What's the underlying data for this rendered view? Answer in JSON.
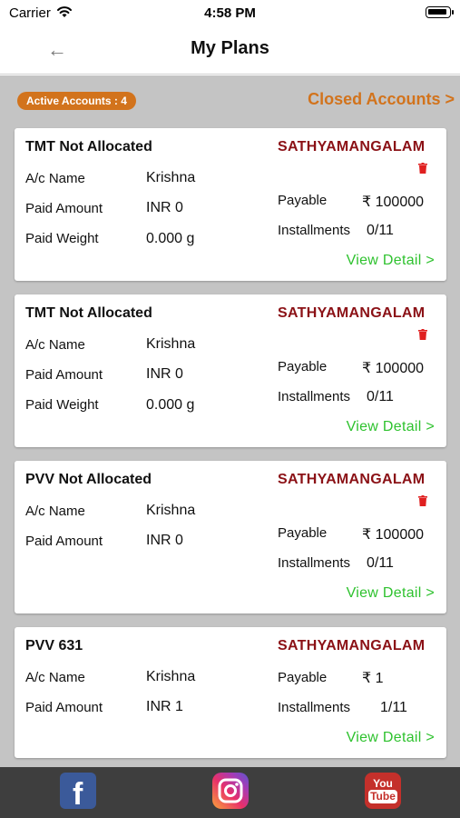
{
  "status_bar": {
    "carrier": "Carrier",
    "time": "4:58 PM"
  },
  "header": {
    "title": "My Plans",
    "back_icon": "←"
  },
  "summary": {
    "active_label": "Active Accounts : 4",
    "closed_link": "Closed Accounts >"
  },
  "labels": {
    "ac_name": "A/c Name",
    "paid_amount": "Paid Amount",
    "paid_weight": "Paid Weight",
    "payable": "Payable",
    "installments": "Installments",
    "view_detail": "View Detail >"
  },
  "plans": [
    {
      "name": "TMT Not Allocated",
      "branch": "SATHYAMANGALAM",
      "ac_name": "Krishna",
      "paid_amount": "INR 0",
      "paid_weight": "0.000 g",
      "payable": "₹ 100000",
      "installments": "0/11"
    },
    {
      "name": "TMT Not Allocated",
      "branch": "SATHYAMANGALAM",
      "ac_name": "Krishna",
      "paid_amount": "INR 0",
      "paid_weight": "0.000 g",
      "payable": "₹ 100000",
      "installments": "0/11"
    },
    {
      "name": "PVV Not Allocated",
      "branch": "SATHYAMANGALAM",
      "ac_name": "Krishna",
      "paid_amount": "INR 0",
      "payable": "₹ 100000",
      "installments": "0/11"
    },
    {
      "name": "PVV 631",
      "branch": "SATHYAMANGALAM",
      "ac_name": "Krishna",
      "paid_amount": "INR 1",
      "payable": "₹ 1",
      "installments": "1/11"
    }
  ],
  "footer": {
    "facebook_glyph": "f",
    "youtube_text_top": "You",
    "youtube_text_bottom": "Tube"
  },
  "colors": {
    "accent_orange": "#d2731c",
    "branch_red": "#8b1116",
    "link_green": "#2ec22e",
    "trash_red": "#e02020",
    "footer_bg": "#3e3e3e",
    "content_bg": "#c4c4c4"
  }
}
